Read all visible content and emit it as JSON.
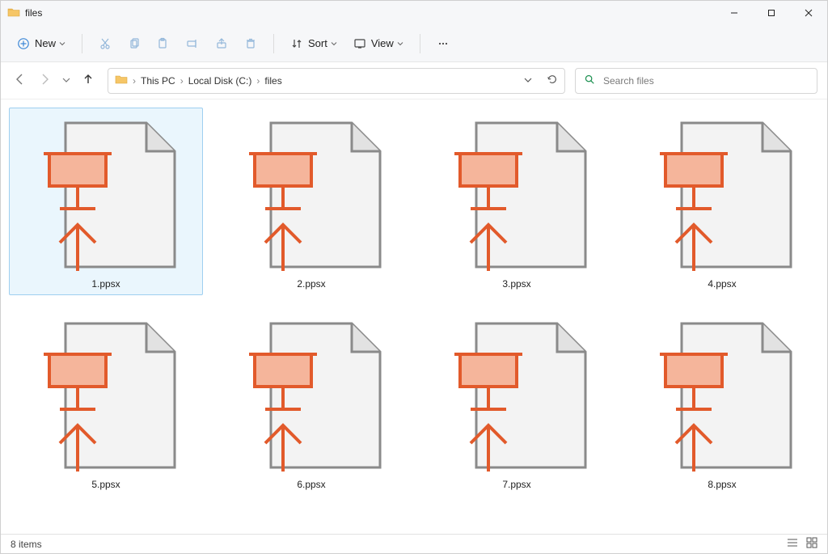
{
  "window": {
    "title": "files"
  },
  "toolbar": {
    "new_label": "New",
    "sort_label": "Sort",
    "view_label": "View"
  },
  "breadcrumb": {
    "items": [
      "This PC",
      "Local Disk (C:)",
      "files"
    ]
  },
  "search": {
    "placeholder": "Search files"
  },
  "files": [
    {
      "name": "1.ppsx",
      "selected": true
    },
    {
      "name": "2.ppsx",
      "selected": false
    },
    {
      "name": "3.ppsx",
      "selected": false
    },
    {
      "name": "4.ppsx",
      "selected": false
    },
    {
      "name": "5.ppsx",
      "selected": false
    },
    {
      "name": "6.ppsx",
      "selected": false
    },
    {
      "name": "7.ppsx",
      "selected": false
    },
    {
      "name": "8.ppsx",
      "selected": false
    }
  ],
  "status": {
    "item_count": "8 items"
  },
  "colors": {
    "accent_orange": "#e25a2b",
    "accent_fill": "#f5b59b",
    "page_gray": "#8a8a8a",
    "page_fill": "#f3f3f3"
  }
}
